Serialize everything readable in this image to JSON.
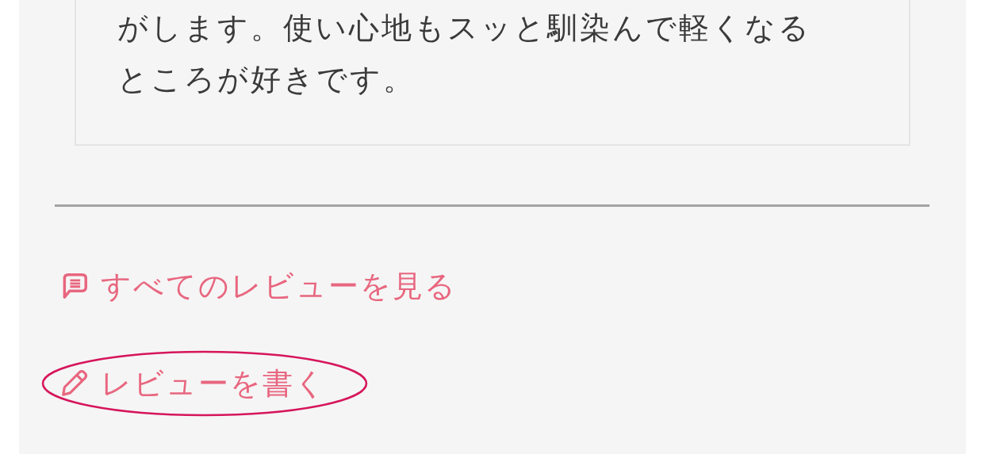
{
  "review_text": "がします。使い心地もスッと馴染んで軽くなるところが好きです。",
  "links": [
    {
      "kind": "comments",
      "label": "すべてのレビューを見る",
      "highlighted": false
    },
    {
      "kind": "write",
      "label": "レビューを書く",
      "highlighted": true
    }
  ]
}
